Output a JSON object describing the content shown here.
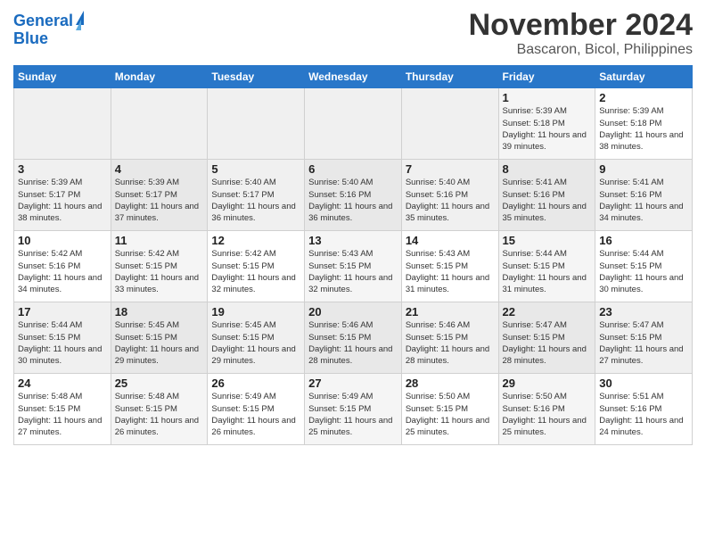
{
  "header": {
    "logo_line1": "General",
    "logo_line2": "Blue",
    "title": "November 2024",
    "subtitle": "Bascaron, Bicol, Philippines"
  },
  "weekdays": [
    "Sunday",
    "Monday",
    "Tuesday",
    "Wednesday",
    "Thursday",
    "Friday",
    "Saturday"
  ],
  "rows": [
    [
      {
        "day": "",
        "sunrise": "",
        "sunset": "",
        "daylight": ""
      },
      {
        "day": "",
        "sunrise": "",
        "sunset": "",
        "daylight": ""
      },
      {
        "day": "",
        "sunrise": "",
        "sunset": "",
        "daylight": ""
      },
      {
        "day": "",
        "sunrise": "",
        "sunset": "",
        "daylight": ""
      },
      {
        "day": "",
        "sunrise": "",
        "sunset": "",
        "daylight": ""
      },
      {
        "day": "1",
        "sunrise": "Sunrise: 5:39 AM",
        "sunset": "Sunset: 5:18 PM",
        "daylight": "Daylight: 11 hours and 39 minutes."
      },
      {
        "day": "2",
        "sunrise": "Sunrise: 5:39 AM",
        "sunset": "Sunset: 5:18 PM",
        "daylight": "Daylight: 11 hours and 38 minutes."
      }
    ],
    [
      {
        "day": "3",
        "sunrise": "Sunrise: 5:39 AM",
        "sunset": "Sunset: 5:17 PM",
        "daylight": "Daylight: 11 hours and 38 minutes."
      },
      {
        "day": "4",
        "sunrise": "Sunrise: 5:39 AM",
        "sunset": "Sunset: 5:17 PM",
        "daylight": "Daylight: 11 hours and 37 minutes."
      },
      {
        "day": "5",
        "sunrise": "Sunrise: 5:40 AM",
        "sunset": "Sunset: 5:17 PM",
        "daylight": "Daylight: 11 hours and 36 minutes."
      },
      {
        "day": "6",
        "sunrise": "Sunrise: 5:40 AM",
        "sunset": "Sunset: 5:16 PM",
        "daylight": "Daylight: 11 hours and 36 minutes."
      },
      {
        "day": "7",
        "sunrise": "Sunrise: 5:40 AM",
        "sunset": "Sunset: 5:16 PM",
        "daylight": "Daylight: 11 hours and 35 minutes."
      },
      {
        "day": "8",
        "sunrise": "Sunrise: 5:41 AM",
        "sunset": "Sunset: 5:16 PM",
        "daylight": "Daylight: 11 hours and 35 minutes."
      },
      {
        "day": "9",
        "sunrise": "Sunrise: 5:41 AM",
        "sunset": "Sunset: 5:16 PM",
        "daylight": "Daylight: 11 hours and 34 minutes."
      }
    ],
    [
      {
        "day": "10",
        "sunrise": "Sunrise: 5:42 AM",
        "sunset": "Sunset: 5:16 PM",
        "daylight": "Daylight: 11 hours and 34 minutes."
      },
      {
        "day": "11",
        "sunrise": "Sunrise: 5:42 AM",
        "sunset": "Sunset: 5:15 PM",
        "daylight": "Daylight: 11 hours and 33 minutes."
      },
      {
        "day": "12",
        "sunrise": "Sunrise: 5:42 AM",
        "sunset": "Sunset: 5:15 PM",
        "daylight": "Daylight: 11 hours and 32 minutes."
      },
      {
        "day": "13",
        "sunrise": "Sunrise: 5:43 AM",
        "sunset": "Sunset: 5:15 PM",
        "daylight": "Daylight: 11 hours and 32 minutes."
      },
      {
        "day": "14",
        "sunrise": "Sunrise: 5:43 AM",
        "sunset": "Sunset: 5:15 PM",
        "daylight": "Daylight: 11 hours and 31 minutes."
      },
      {
        "day": "15",
        "sunrise": "Sunrise: 5:44 AM",
        "sunset": "Sunset: 5:15 PM",
        "daylight": "Daylight: 11 hours and 31 minutes."
      },
      {
        "day": "16",
        "sunrise": "Sunrise: 5:44 AM",
        "sunset": "Sunset: 5:15 PM",
        "daylight": "Daylight: 11 hours and 30 minutes."
      }
    ],
    [
      {
        "day": "17",
        "sunrise": "Sunrise: 5:44 AM",
        "sunset": "Sunset: 5:15 PM",
        "daylight": "Daylight: 11 hours and 30 minutes."
      },
      {
        "day": "18",
        "sunrise": "Sunrise: 5:45 AM",
        "sunset": "Sunset: 5:15 PM",
        "daylight": "Daylight: 11 hours and 29 minutes."
      },
      {
        "day": "19",
        "sunrise": "Sunrise: 5:45 AM",
        "sunset": "Sunset: 5:15 PM",
        "daylight": "Daylight: 11 hours and 29 minutes."
      },
      {
        "day": "20",
        "sunrise": "Sunrise: 5:46 AM",
        "sunset": "Sunset: 5:15 PM",
        "daylight": "Daylight: 11 hours and 28 minutes."
      },
      {
        "day": "21",
        "sunrise": "Sunrise: 5:46 AM",
        "sunset": "Sunset: 5:15 PM",
        "daylight": "Daylight: 11 hours and 28 minutes."
      },
      {
        "day": "22",
        "sunrise": "Sunrise: 5:47 AM",
        "sunset": "Sunset: 5:15 PM",
        "daylight": "Daylight: 11 hours and 28 minutes."
      },
      {
        "day": "23",
        "sunrise": "Sunrise: 5:47 AM",
        "sunset": "Sunset: 5:15 PM",
        "daylight": "Daylight: 11 hours and 27 minutes."
      }
    ],
    [
      {
        "day": "24",
        "sunrise": "Sunrise: 5:48 AM",
        "sunset": "Sunset: 5:15 PM",
        "daylight": "Daylight: 11 hours and 27 minutes."
      },
      {
        "day": "25",
        "sunrise": "Sunrise: 5:48 AM",
        "sunset": "Sunset: 5:15 PM",
        "daylight": "Daylight: 11 hours and 26 minutes."
      },
      {
        "day": "26",
        "sunrise": "Sunrise: 5:49 AM",
        "sunset": "Sunset: 5:15 PM",
        "daylight": "Daylight: 11 hours and 26 minutes."
      },
      {
        "day": "27",
        "sunrise": "Sunrise: 5:49 AM",
        "sunset": "Sunset: 5:15 PM",
        "daylight": "Daylight: 11 hours and 25 minutes."
      },
      {
        "day": "28",
        "sunrise": "Sunrise: 5:50 AM",
        "sunset": "Sunset: 5:15 PM",
        "daylight": "Daylight: 11 hours and 25 minutes."
      },
      {
        "day": "29",
        "sunrise": "Sunrise: 5:50 AM",
        "sunset": "Sunset: 5:16 PM",
        "daylight": "Daylight: 11 hours and 25 minutes."
      },
      {
        "day": "30",
        "sunrise": "Sunrise: 5:51 AM",
        "sunset": "Sunset: 5:16 PM",
        "daylight": "Daylight: 11 hours and 24 minutes."
      }
    ]
  ]
}
